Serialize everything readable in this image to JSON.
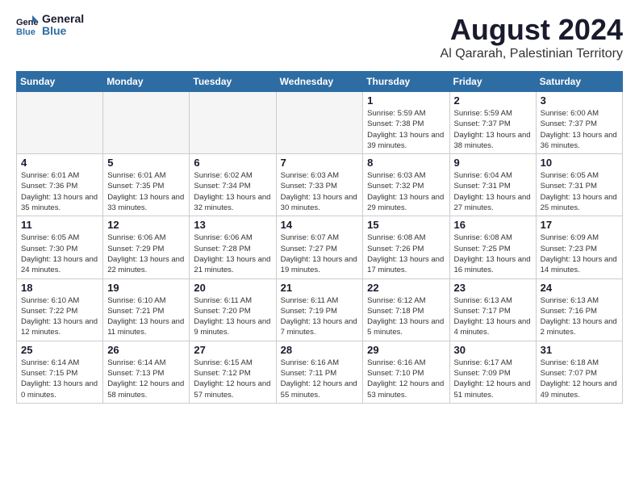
{
  "logo": {
    "line1": "General",
    "line2": "Blue"
  },
  "title": "August 2024",
  "subtitle": "Al Qararah, Palestinian Territory",
  "days_of_week": [
    "Sunday",
    "Monday",
    "Tuesday",
    "Wednesday",
    "Thursday",
    "Friday",
    "Saturday"
  ],
  "weeks": [
    [
      {
        "day": "",
        "info": ""
      },
      {
        "day": "",
        "info": ""
      },
      {
        "day": "",
        "info": ""
      },
      {
        "day": "",
        "info": ""
      },
      {
        "day": "1",
        "sunrise": "Sunrise: 5:59 AM",
        "sunset": "Sunset: 7:38 PM",
        "daylight": "Daylight: 13 hours and 39 minutes."
      },
      {
        "day": "2",
        "sunrise": "Sunrise: 5:59 AM",
        "sunset": "Sunset: 7:37 PM",
        "daylight": "Daylight: 13 hours and 38 minutes."
      },
      {
        "day": "3",
        "sunrise": "Sunrise: 6:00 AM",
        "sunset": "Sunset: 7:37 PM",
        "daylight": "Daylight: 13 hours and 36 minutes."
      }
    ],
    [
      {
        "day": "4",
        "sunrise": "Sunrise: 6:01 AM",
        "sunset": "Sunset: 7:36 PM",
        "daylight": "Daylight: 13 hours and 35 minutes."
      },
      {
        "day": "5",
        "sunrise": "Sunrise: 6:01 AM",
        "sunset": "Sunset: 7:35 PM",
        "daylight": "Daylight: 13 hours and 33 minutes."
      },
      {
        "day": "6",
        "sunrise": "Sunrise: 6:02 AM",
        "sunset": "Sunset: 7:34 PM",
        "daylight": "Daylight: 13 hours and 32 minutes."
      },
      {
        "day": "7",
        "sunrise": "Sunrise: 6:03 AM",
        "sunset": "Sunset: 7:33 PM",
        "daylight": "Daylight: 13 hours and 30 minutes."
      },
      {
        "day": "8",
        "sunrise": "Sunrise: 6:03 AM",
        "sunset": "Sunset: 7:32 PM",
        "daylight": "Daylight: 13 hours and 29 minutes."
      },
      {
        "day": "9",
        "sunrise": "Sunrise: 6:04 AM",
        "sunset": "Sunset: 7:31 PM",
        "daylight": "Daylight: 13 hours and 27 minutes."
      },
      {
        "day": "10",
        "sunrise": "Sunrise: 6:05 AM",
        "sunset": "Sunset: 7:31 PM",
        "daylight": "Daylight: 13 hours and 25 minutes."
      }
    ],
    [
      {
        "day": "11",
        "sunrise": "Sunrise: 6:05 AM",
        "sunset": "Sunset: 7:30 PM",
        "daylight": "Daylight: 13 hours and 24 minutes."
      },
      {
        "day": "12",
        "sunrise": "Sunrise: 6:06 AM",
        "sunset": "Sunset: 7:29 PM",
        "daylight": "Daylight: 13 hours and 22 minutes."
      },
      {
        "day": "13",
        "sunrise": "Sunrise: 6:06 AM",
        "sunset": "Sunset: 7:28 PM",
        "daylight": "Daylight: 13 hours and 21 minutes."
      },
      {
        "day": "14",
        "sunrise": "Sunrise: 6:07 AM",
        "sunset": "Sunset: 7:27 PM",
        "daylight": "Daylight: 13 hours and 19 minutes."
      },
      {
        "day": "15",
        "sunrise": "Sunrise: 6:08 AM",
        "sunset": "Sunset: 7:26 PM",
        "daylight": "Daylight: 13 hours and 17 minutes."
      },
      {
        "day": "16",
        "sunrise": "Sunrise: 6:08 AM",
        "sunset": "Sunset: 7:25 PM",
        "daylight": "Daylight: 13 hours and 16 minutes."
      },
      {
        "day": "17",
        "sunrise": "Sunrise: 6:09 AM",
        "sunset": "Sunset: 7:23 PM",
        "daylight": "Daylight: 13 hours and 14 minutes."
      }
    ],
    [
      {
        "day": "18",
        "sunrise": "Sunrise: 6:10 AM",
        "sunset": "Sunset: 7:22 PM",
        "daylight": "Daylight: 13 hours and 12 minutes."
      },
      {
        "day": "19",
        "sunrise": "Sunrise: 6:10 AM",
        "sunset": "Sunset: 7:21 PM",
        "daylight": "Daylight: 13 hours and 11 minutes."
      },
      {
        "day": "20",
        "sunrise": "Sunrise: 6:11 AM",
        "sunset": "Sunset: 7:20 PM",
        "daylight": "Daylight: 13 hours and 9 minutes."
      },
      {
        "day": "21",
        "sunrise": "Sunrise: 6:11 AM",
        "sunset": "Sunset: 7:19 PM",
        "daylight": "Daylight: 13 hours and 7 minutes."
      },
      {
        "day": "22",
        "sunrise": "Sunrise: 6:12 AM",
        "sunset": "Sunset: 7:18 PM",
        "daylight": "Daylight: 13 hours and 5 minutes."
      },
      {
        "day": "23",
        "sunrise": "Sunrise: 6:13 AM",
        "sunset": "Sunset: 7:17 PM",
        "daylight": "Daylight: 13 hours and 4 minutes."
      },
      {
        "day": "24",
        "sunrise": "Sunrise: 6:13 AM",
        "sunset": "Sunset: 7:16 PM",
        "daylight": "Daylight: 13 hours and 2 minutes."
      }
    ],
    [
      {
        "day": "25",
        "sunrise": "Sunrise: 6:14 AM",
        "sunset": "Sunset: 7:15 PM",
        "daylight": "Daylight: 13 hours and 0 minutes."
      },
      {
        "day": "26",
        "sunrise": "Sunrise: 6:14 AM",
        "sunset": "Sunset: 7:13 PM",
        "daylight": "Daylight: 12 hours and 58 minutes."
      },
      {
        "day": "27",
        "sunrise": "Sunrise: 6:15 AM",
        "sunset": "Sunset: 7:12 PM",
        "daylight": "Daylight: 12 hours and 57 minutes."
      },
      {
        "day": "28",
        "sunrise": "Sunrise: 6:16 AM",
        "sunset": "Sunset: 7:11 PM",
        "daylight": "Daylight: 12 hours and 55 minutes."
      },
      {
        "day": "29",
        "sunrise": "Sunrise: 6:16 AM",
        "sunset": "Sunset: 7:10 PM",
        "daylight": "Daylight: 12 hours and 53 minutes."
      },
      {
        "day": "30",
        "sunrise": "Sunrise: 6:17 AM",
        "sunset": "Sunset: 7:09 PM",
        "daylight": "Daylight: 12 hours and 51 minutes."
      },
      {
        "day": "31",
        "sunrise": "Sunrise: 6:18 AM",
        "sunset": "Sunset: 7:07 PM",
        "daylight": "Daylight: 12 hours and 49 minutes."
      }
    ]
  ]
}
